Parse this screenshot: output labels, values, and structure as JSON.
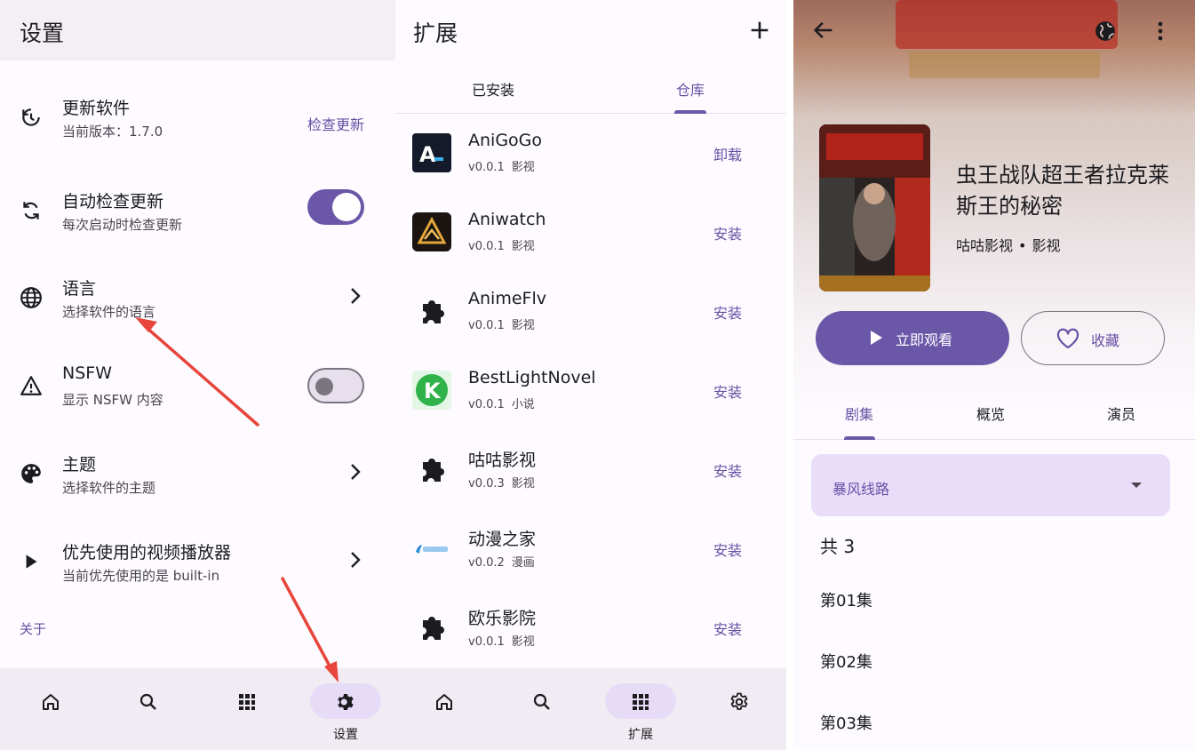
{
  "settings": {
    "title": "设置",
    "items": [
      {
        "title": "更新软件",
        "subtitle": "当前版本：1.7.0",
        "action": "检查更新",
        "icon": "update-icon"
      },
      {
        "title": "自动检查更新",
        "subtitle": "每次启动时检查更新",
        "icon": "sync-icon",
        "toggle": true
      },
      {
        "title": "语言",
        "subtitle": "选择软件的语言",
        "icon": "globe-icon"
      },
      {
        "title": "NSFW",
        "subtitle": "显示 NSFW 内容",
        "icon": "warning-icon",
        "toggle": false
      },
      {
        "title": "主题",
        "subtitle": "选择软件的主题",
        "icon": "palette-icon"
      },
      {
        "title": "优先使用的视频播放器",
        "subtitle": "当前优先使用的是 built-in",
        "icon": "play-icon"
      }
    ],
    "about": "关于",
    "nav": [
      {
        "icon": "home-icon",
        "label": ""
      },
      {
        "icon": "search-icon",
        "label": ""
      },
      {
        "icon": "grid-icon",
        "label": ""
      },
      {
        "icon": "gear-icon",
        "label": "设置",
        "active": true
      }
    ]
  },
  "extensions": {
    "title": "扩展",
    "tabs": [
      "已安装",
      "仓库"
    ],
    "active_tab": "仓库",
    "items": [
      {
        "name": "AniGoGo",
        "version": "v0.0.1",
        "type": "影视",
        "action": "卸载"
      },
      {
        "name": "Aniwatch",
        "version": "v0.0.1",
        "type": "影视",
        "action": "安装"
      },
      {
        "name": "AnimeFlv",
        "version": "v0.0.1",
        "type": "影视",
        "action": "安装"
      },
      {
        "name": "BestLightNovel",
        "version": "v0.0.1",
        "type": "小说",
        "action": "安装"
      },
      {
        "name": "咕咕影视",
        "version": "v0.0.3",
        "type": "影视",
        "action": "安装"
      },
      {
        "name": "动漫之家",
        "version": "v0.0.2",
        "type": "漫画",
        "action": "安装"
      },
      {
        "name": "欧乐影院",
        "version": "v0.0.1",
        "type": "影视",
        "action": "安装"
      }
    ],
    "nav": [
      {
        "icon": "home-icon",
        "label": ""
      },
      {
        "icon": "search-icon",
        "label": ""
      },
      {
        "icon": "grid-icon",
        "label": "扩展",
        "active": true
      },
      {
        "icon": "gear-icon",
        "label": ""
      }
    ]
  },
  "detail": {
    "title": "虫王战队超王者拉克莱斯王的秘密",
    "source": "咕咕影视",
    "category": "影视",
    "watch_label": "立即观看",
    "favorite_label": "收藏",
    "tabs": [
      "剧集",
      "概览",
      "演员"
    ],
    "active_tab": "剧集",
    "route": "暴风线路",
    "episode_count": "共 3",
    "episodes": [
      "第01集",
      "第02集",
      "第03集"
    ]
  },
  "colors": {
    "primary": "#6b57a8",
    "accent_text": "#6750a4",
    "surface": "#fdfbff",
    "nav_bg": "#f1ecf4",
    "annotation_arrow": "#e8453c"
  }
}
